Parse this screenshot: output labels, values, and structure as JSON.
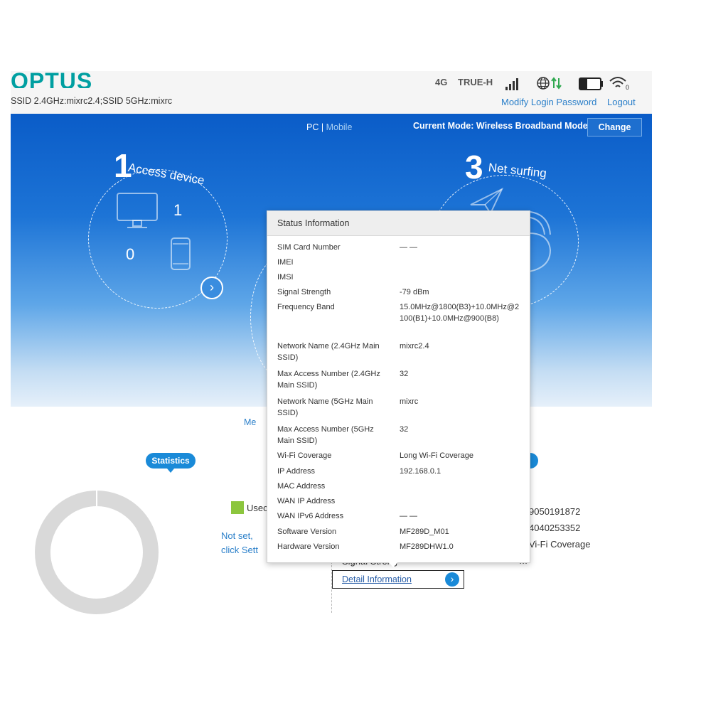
{
  "header": {
    "logo": "OPTUS",
    "ssid": "SSID 2.4GHz:mixrc2.4;SSID 5GHz:mixrc",
    "network_type": "4G",
    "carrier": "TRUE-H",
    "modify_password": "Modify Login Password",
    "logout": "Logout",
    "battery_level": 0.3
  },
  "banner": {
    "pc": "PC",
    "separator": "|",
    "mobile": "Mobile",
    "current_mode": "Current Mode: Wireless Broadband Mode",
    "change": "Change",
    "step1_num": "1",
    "step1_text": "Access device",
    "step3_num": "3",
    "step3_text": "Net surfing",
    "wired_count": "1",
    "wireless_count": "0"
  },
  "popup": {
    "title": "Status Information",
    "rows": [
      {
        "label": "SIM Card Number",
        "value": "— —"
      },
      {
        "label": "IMEI",
        "value": ""
      },
      {
        "label": "IMSI",
        "value": ""
      },
      {
        "label": "Signal Strength",
        "value": "-79 dBm"
      },
      {
        "label": "Frequency Band",
        "value": "15.0MHz@1800(B3)+10.0MHz@2100(B1)+10.0MHz@900(B8)"
      },
      {
        "label": "Network Name (2.4GHz Main SSID)",
        "value": "mixrc2.4"
      },
      {
        "label": "Max Access Number (2.4GHz Main SSID)",
        "value": "32"
      },
      {
        "label": "Network Name (5GHz Main SSID)",
        "value": "mixrc"
      },
      {
        "label": "Max Access Number (5GHz Main SSID)",
        "value": "32"
      },
      {
        "label": "Wi-Fi Coverage",
        "value": "Long Wi-Fi Coverage"
      },
      {
        "label": "IP Address",
        "value": "192.168.0.1"
      },
      {
        "label": "MAC Address",
        "value": ""
      },
      {
        "label": "WAN IP Address",
        "value": ""
      },
      {
        "label": "WAN IPv6 Address",
        "value": "— —"
      },
      {
        "label": "Software Version",
        "value": "MF289D_M01"
      },
      {
        "label": "Hardware Version",
        "value": "MF289DHW1.0"
      }
    ]
  },
  "below": {
    "me_text": "Me",
    "statistics": "Statistics",
    "used": "Usec",
    "not_set_1": "Not set,",
    "not_set_2": "click Sett",
    "right_val_1": "9050191872",
    "right_val_2": "4040253352",
    "right_val_3": "Vi-Fi Coverage",
    "right_val_4": "-- -m",
    "signal_partial": "Signal Streng",
    "detail_information": "Detail Information"
  },
  "colors": {
    "brand": "#009fa1",
    "link": "#2a7fc9",
    "banner_top": "#0a5cc8",
    "used_green": "#8cc63e",
    "donut_gray": "#d9d9d9"
  }
}
